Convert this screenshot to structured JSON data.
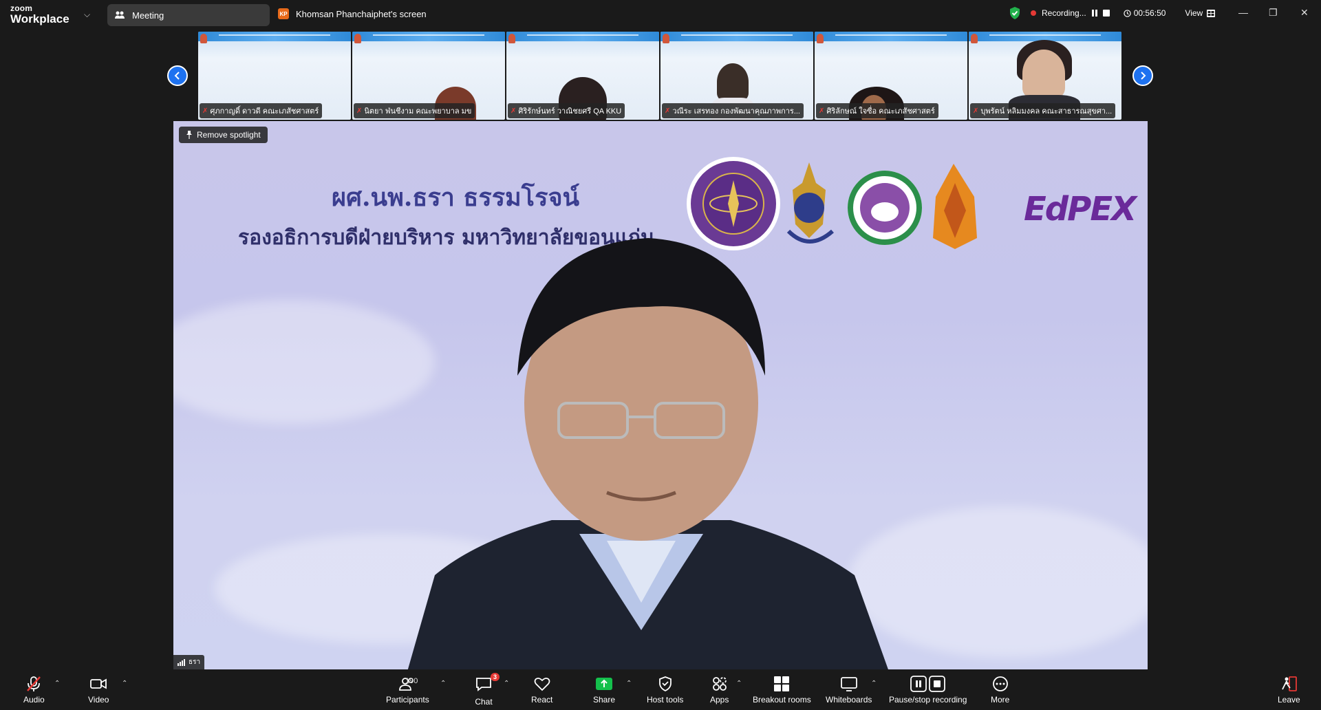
{
  "titlebar": {
    "logo_line1": "zoom",
    "logo_line2": "Workplace",
    "meeting_tab": "Meeting",
    "screen_badge": "KP",
    "screen_tab": "Khomsan Phanchaiphet's screen",
    "recording_label": "Recording...",
    "timer": "00:56:50",
    "view_label": "View"
  },
  "filmstrip": {
    "participants": [
      "ศุภกาญดิ์ ดาวดี คณะเภสัชศาสตร์",
      "นิตยา ฟ่นชีงาม คณะพยาบาล มข",
      "ศิริรักษ์นทร์ วาณิชยศรี QA KKU",
      "วณีระ เสรทอง กองพัฒนาคุณภาพการ...",
      "ศิริลักษณ์ ใจซื่อ คณะเภสัชศาสตร์",
      "บุพรัตน์ หลิมมงคล คณะสาธารณสุขศา..."
    ]
  },
  "main": {
    "spotlight_label": "Remove spotlight",
    "slide_name": "ผศ.นพ.ธรา ธรรมโรจน์",
    "slide_role": "รองอธิการบดีฝ่ายบริหาร มหาวิทยาลัยขอนแก่น",
    "logo_text": "EdPEX",
    "speaker_name": "ธรา"
  },
  "toolbar": {
    "audio": "Audio",
    "video": "Video",
    "participants": "Participants",
    "participant_count": "190",
    "chat": "Chat",
    "chat_badge": "3",
    "react": "React",
    "share": "Share",
    "host_tools": "Host tools",
    "apps": "Apps",
    "breakout": "Breakout rooms",
    "whiteboards": "Whiteboards",
    "pause_recording": "Pause/stop recording",
    "more": "More",
    "leave": "Leave"
  },
  "colors": {
    "accent_blue": "#1e72f0",
    "share_green": "#14c04c",
    "danger_red": "#e53935",
    "slide_bg": "#c8c6ea"
  }
}
